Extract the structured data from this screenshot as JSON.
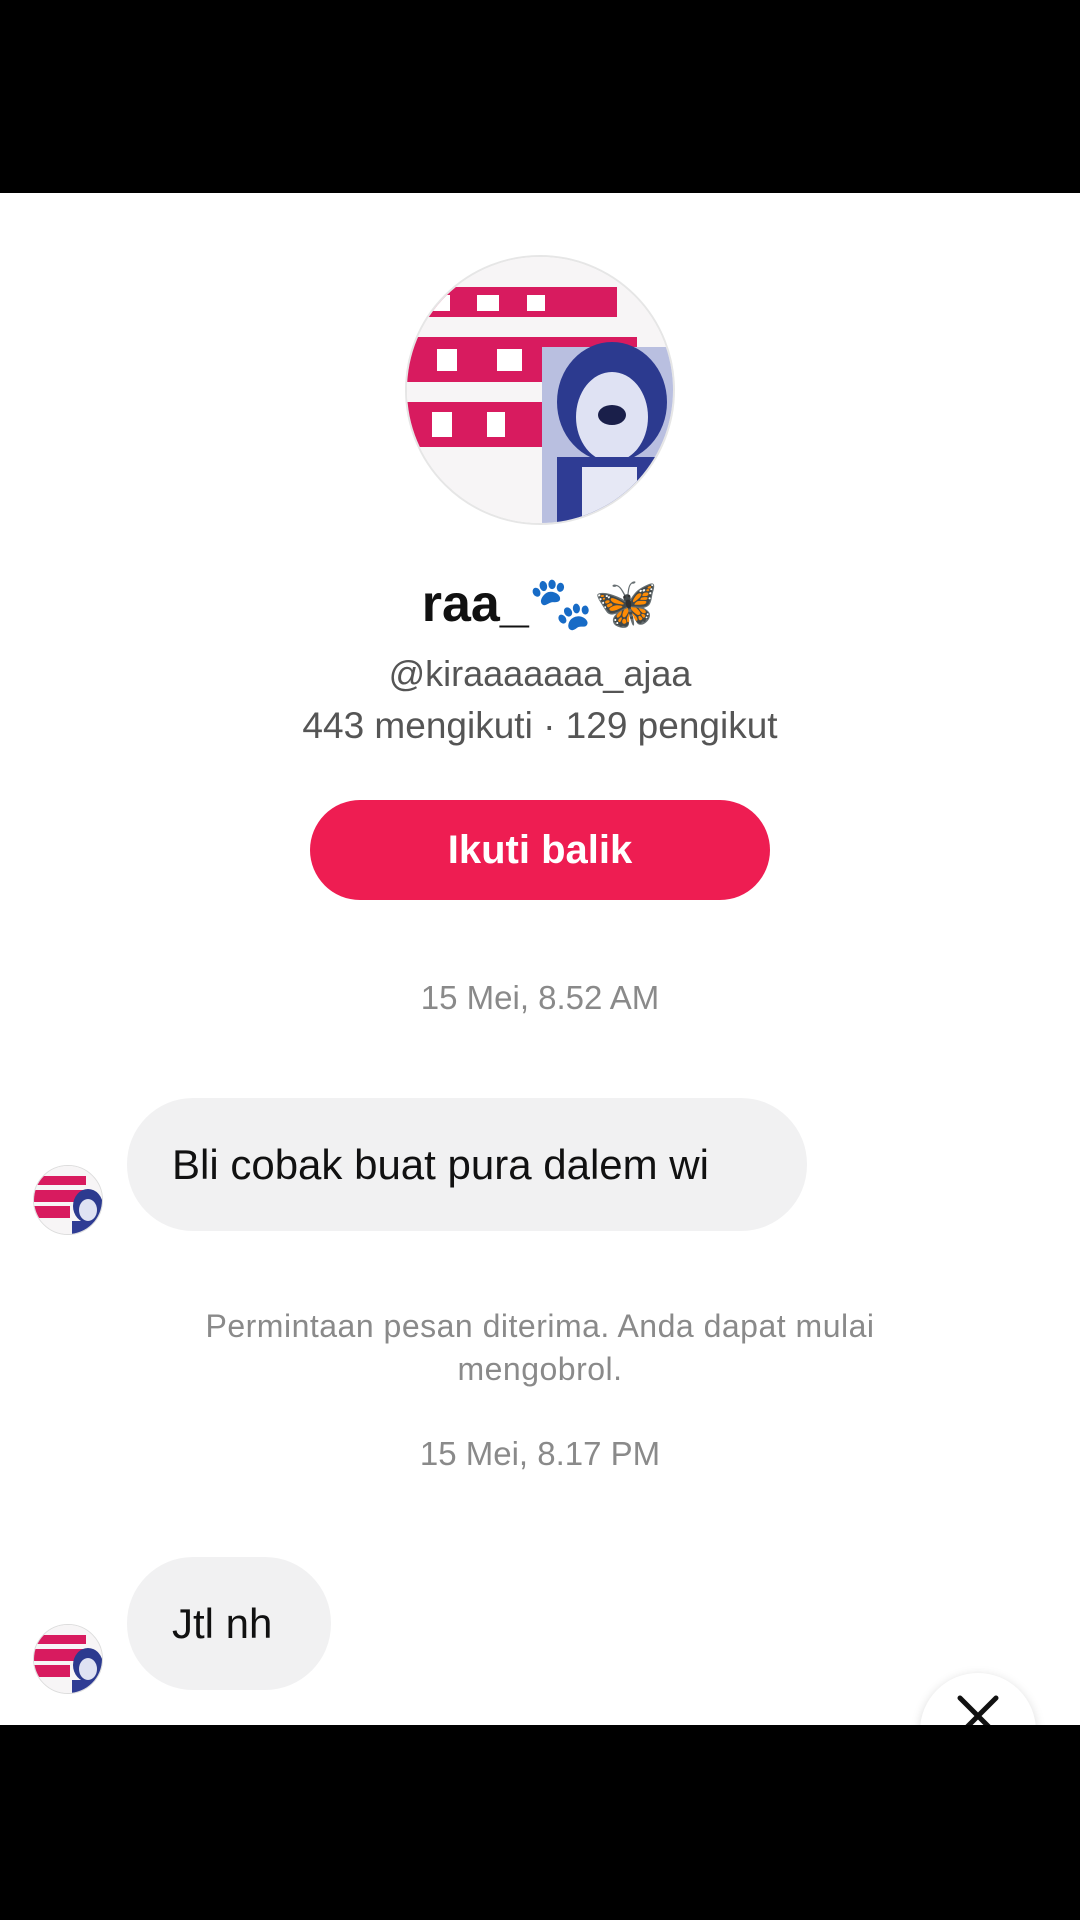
{
  "profile": {
    "display_name": "raa_",
    "name_emoji": "🐾🦋",
    "handle": "@kiraaaaaaa_ajaa",
    "stats": "443 mengikuti · 129 pengikut",
    "follow_back_label": "Ikuti balik"
  },
  "conversation": {
    "timestamp_1": "15 Mei, 8.52 AM",
    "message_1": "Bli cobak buat pura dalem wi",
    "system_note": "Permintaan pesan diterima. Anda dapat mulai mengobrol.",
    "timestamp_2": "15 Mei, 8.17 PM",
    "message_2": "Jtl nh"
  },
  "icons": {
    "close": "close-icon",
    "avatar": "profile-avatar"
  },
  "colors": {
    "accent": "#ee1d52",
    "bubble": "#f1f1f2",
    "muted_text": "#8a8a8a"
  }
}
